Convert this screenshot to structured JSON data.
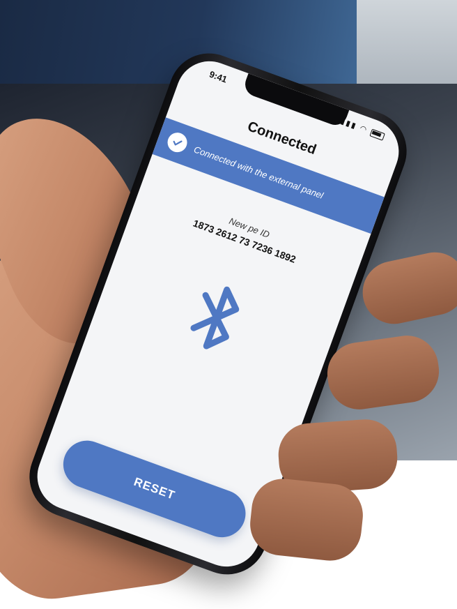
{
  "status_bar": {
    "time": "9:41",
    "signal_icon": "signal-icon",
    "wifi_icon": "wifi-icon",
    "battery_icon": "battery-icon"
  },
  "screen": {
    "title": "Connected",
    "banner": {
      "text": "Connected with  the external panel",
      "icon": "check-icon"
    },
    "pe_id_label": "New pe ID",
    "pe_id_value": "1873 2612 73 7236 1892",
    "center_icon": "bluetooth-icon",
    "reset_label": "RESET"
  },
  "colors": {
    "accent": "#4f78c3",
    "screen_bg": "#f4f5f7",
    "text": "#111111"
  }
}
